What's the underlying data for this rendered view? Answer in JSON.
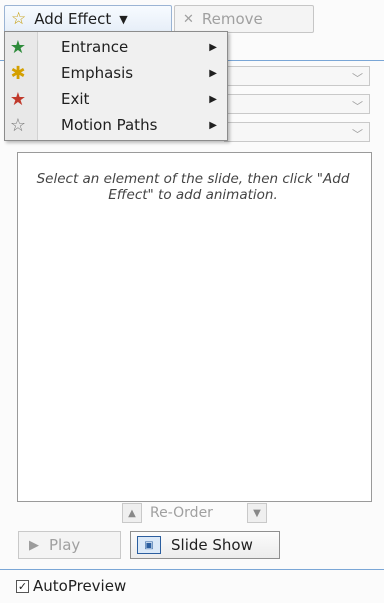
{
  "toolbar": {
    "add_effect_label": "Add Effect",
    "remove_label": "Remove"
  },
  "menu": {
    "items": [
      {
        "label": "Entrance",
        "icon": "entrance-star-icon",
        "color": "#2e8b3b"
      },
      {
        "label": "Emphasis",
        "icon": "emphasis-star-icon",
        "color": "#d4a000"
      },
      {
        "label": "Exit",
        "icon": "exit-star-icon",
        "color": "#c0392b"
      },
      {
        "label": "Motion Paths",
        "icon": "motion-path-star-icon",
        "color": "#777777"
      }
    ]
  },
  "list": {
    "hint": "Select an element of the slide, then click \"Add Effect\" to add animation."
  },
  "reorder": {
    "label": "Re-Order"
  },
  "buttons": {
    "play_label": "Play",
    "slideshow_label": "Slide Show"
  },
  "autopreview": {
    "label": "AutoPreview",
    "checked": true
  }
}
